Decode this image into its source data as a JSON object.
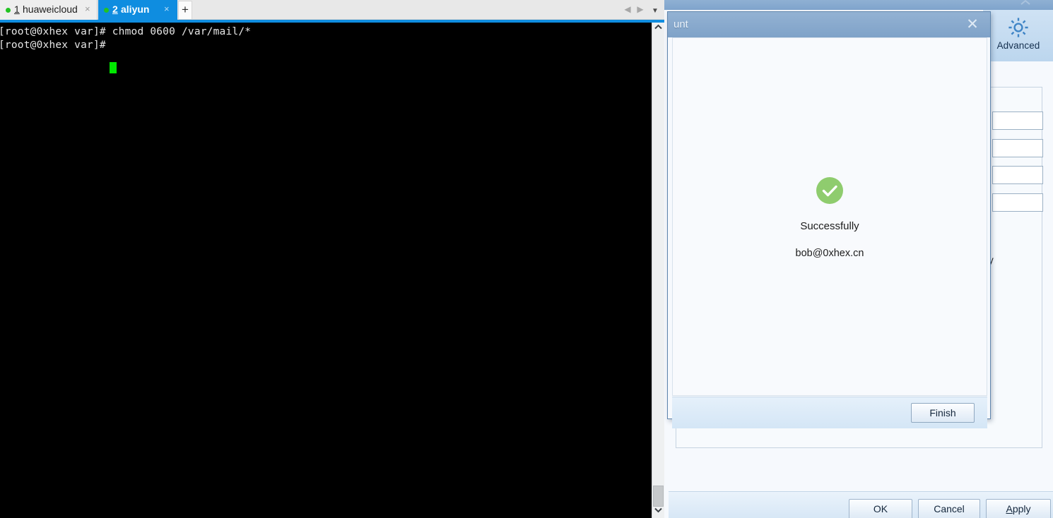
{
  "background_window": {
    "titlebar_color": "#7fa4cc",
    "collapse_icon": "chevron-up-icon",
    "ribbon": {
      "advanced_label": "Advanced",
      "advanced_icon": "gear-icon"
    },
    "form_fragment_text": "ly",
    "buttons": {
      "ok": "OK",
      "cancel": "Cancel",
      "apply_prefix": "A",
      "apply_suffix": "pply"
    }
  },
  "modal": {
    "title": "unt",
    "close_icon": "close-icon",
    "status_icon": "check-circle-icon",
    "status_icon_color": "#8fcc6e",
    "status_title": "Successfully",
    "account_email": "bob@0xhex.cn",
    "finish_label": "Finish"
  },
  "terminal": {
    "tabs": [
      {
        "num": "1",
        "name": "huaweicloud",
        "active": false,
        "close_label": "×",
        "status_dot_color": "#22c322"
      },
      {
        "num": "2",
        "name": "aliyun",
        "active": true,
        "close_label": "×",
        "status_dot_color": "#22c322"
      }
    ],
    "new_tab_label": "+",
    "nav": {
      "prev_icon": "triangle-left-icon",
      "next_icon": "triangle-right-icon",
      "dropdown_icon": "chevron-down-icon",
      "prev_glyph": "◀",
      "next_glyph": "▶",
      "dropdown_glyph": "▼"
    },
    "accent_color": "#0f8de0",
    "lines": [
      "[root@0xhex var]# chmod 0600 /var/mail/*",
      "[root@0xhex var]# "
    ],
    "cursor_color": "#00e800",
    "scrollbar": {
      "up_glyph": "∧",
      "down_glyph": "∨"
    }
  }
}
